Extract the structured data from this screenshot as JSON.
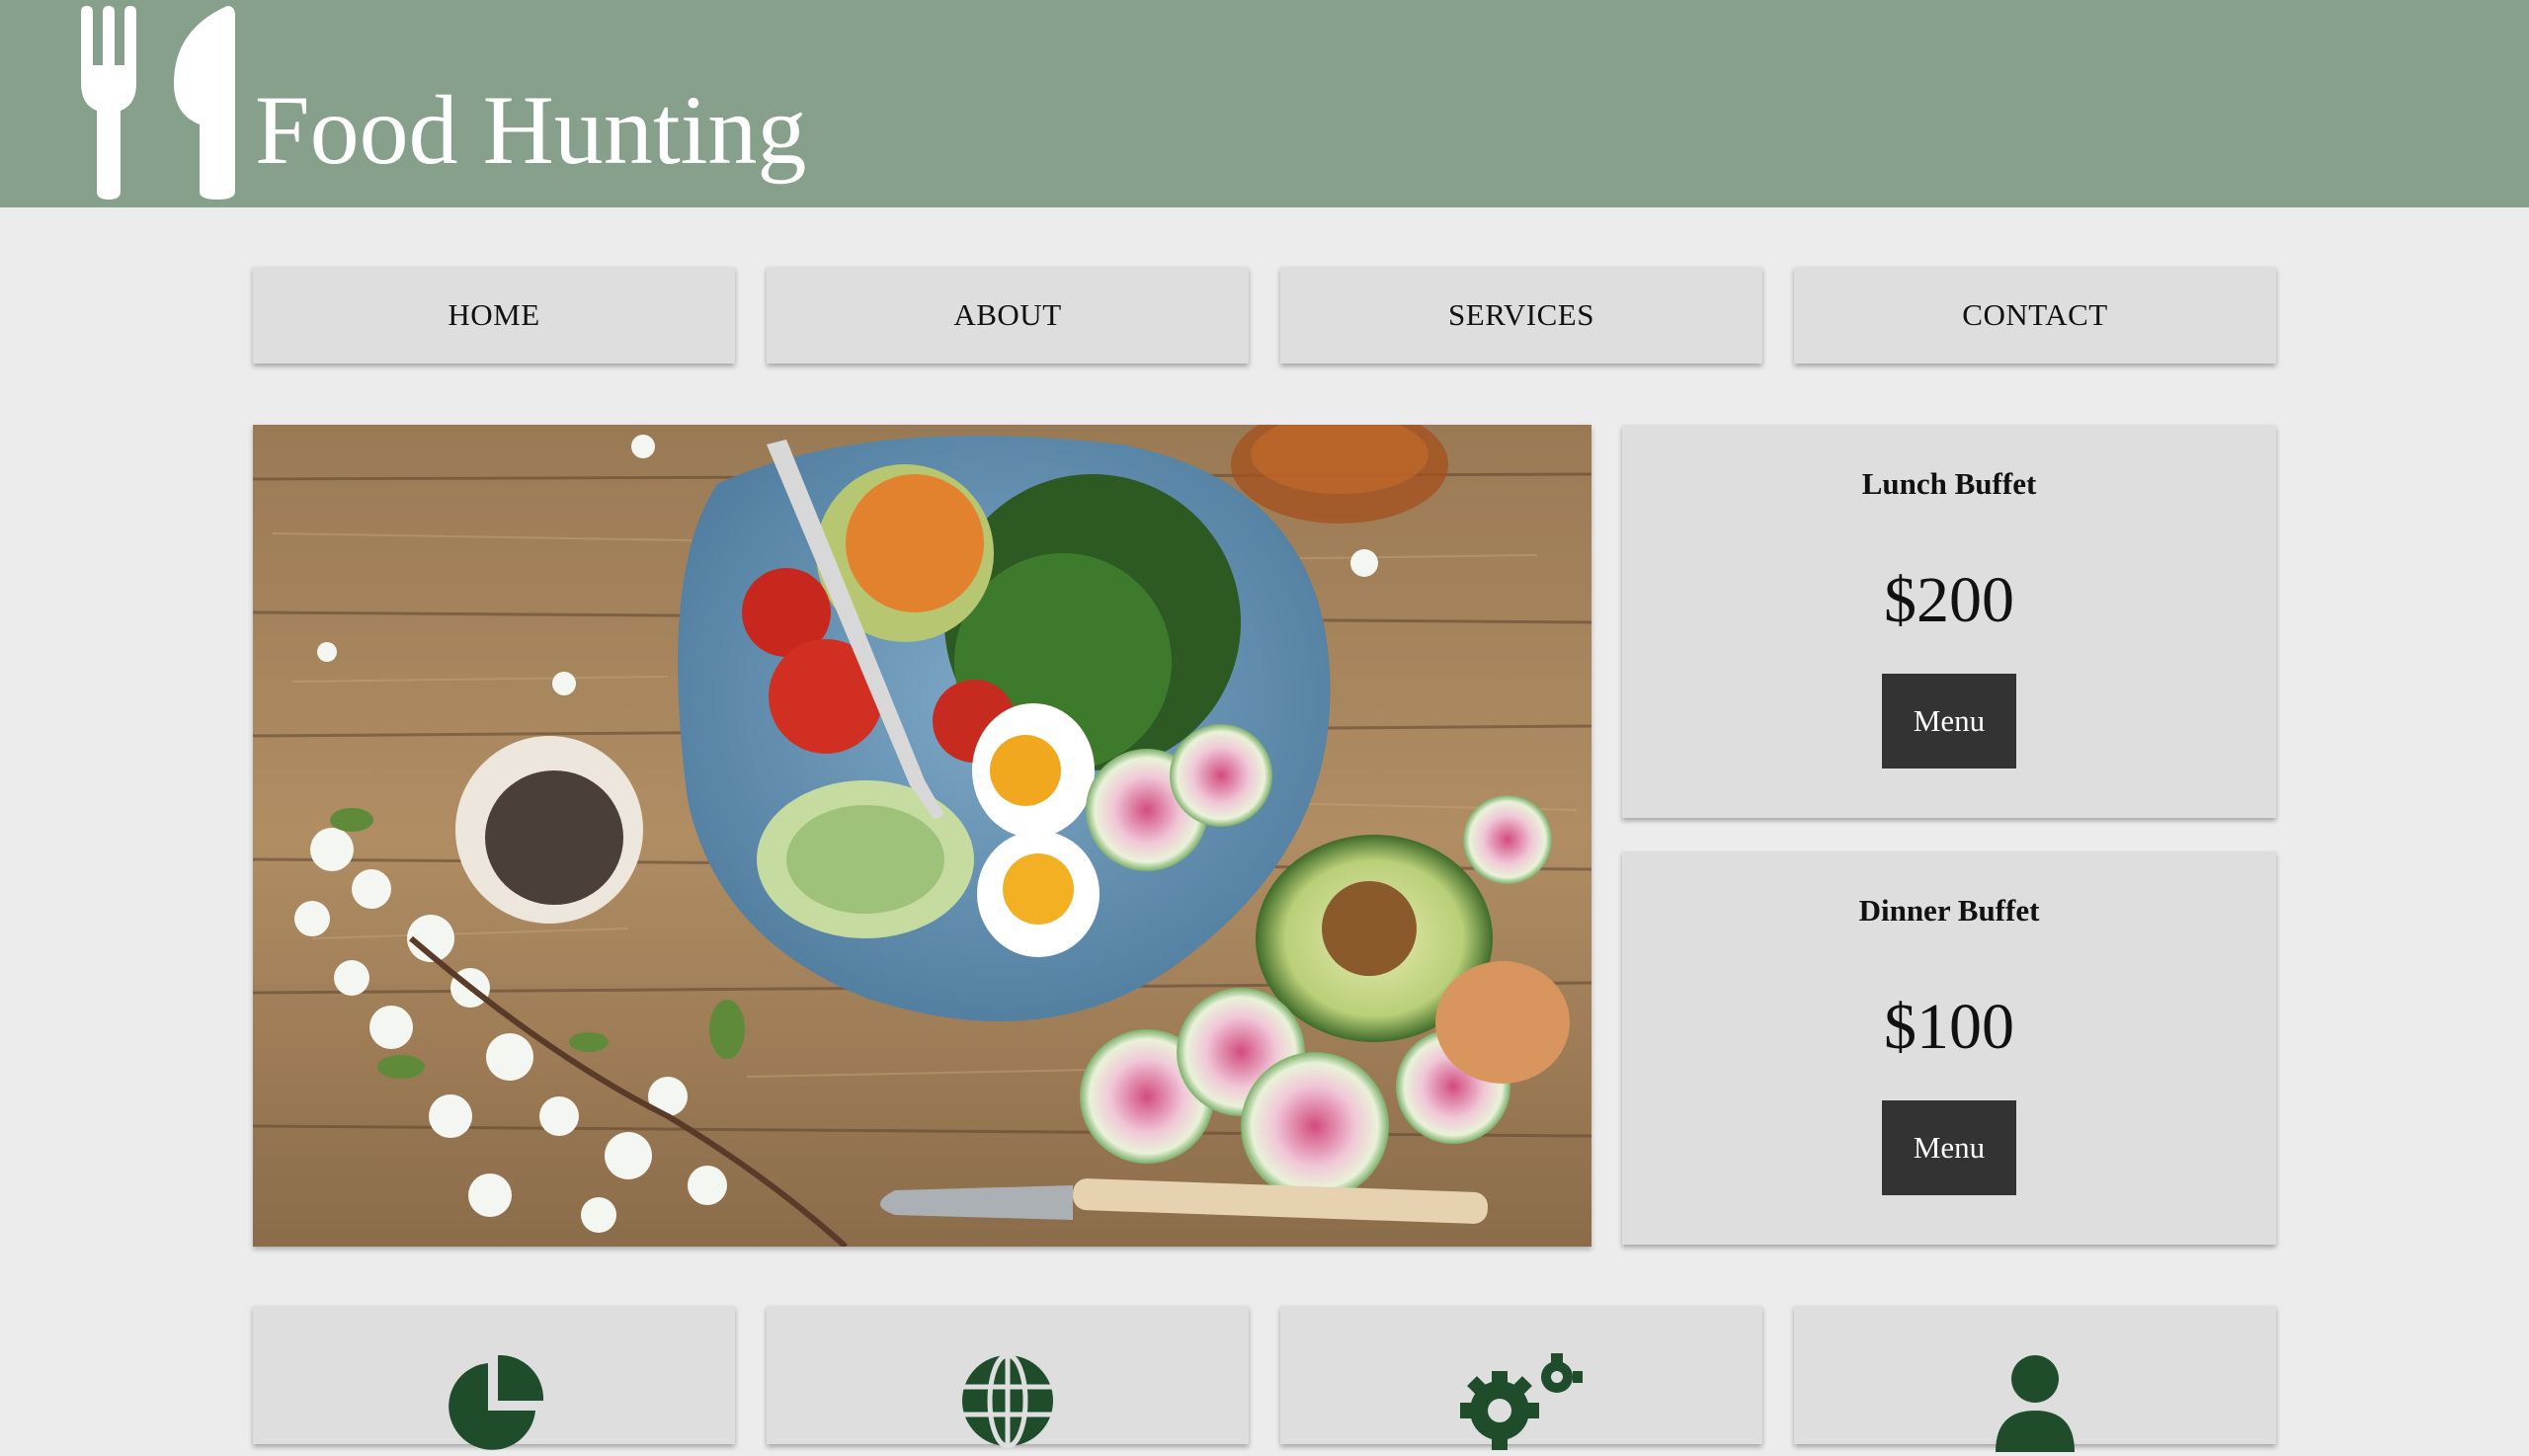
{
  "header": {
    "title": "Food Hunting",
    "logo_icon": "fork-knife-icon",
    "background": "#86a08c"
  },
  "nav": {
    "items": [
      {
        "label": "HOME"
      },
      {
        "label": "ABOUT"
      },
      {
        "label": "SERVICES"
      },
      {
        "label": "CONTACT"
      }
    ]
  },
  "hero": {
    "image": "salad-bowl-photo"
  },
  "cards": [
    {
      "title": "Lunch Buffet",
      "price": "$200",
      "button": "Menu"
    },
    {
      "title": "Dinner Buffet",
      "price": "$100",
      "button": "Menu"
    }
  ],
  "features": [
    {
      "icon": "pie-chart-icon"
    },
    {
      "icon": "globe-icon"
    },
    {
      "icon": "gears-icon"
    },
    {
      "icon": "user-icon"
    }
  ],
  "colors": {
    "accent": "#1f4d2b",
    "button_dark": "#333333",
    "panel": "#dedede",
    "page_bg": "#ececec"
  }
}
